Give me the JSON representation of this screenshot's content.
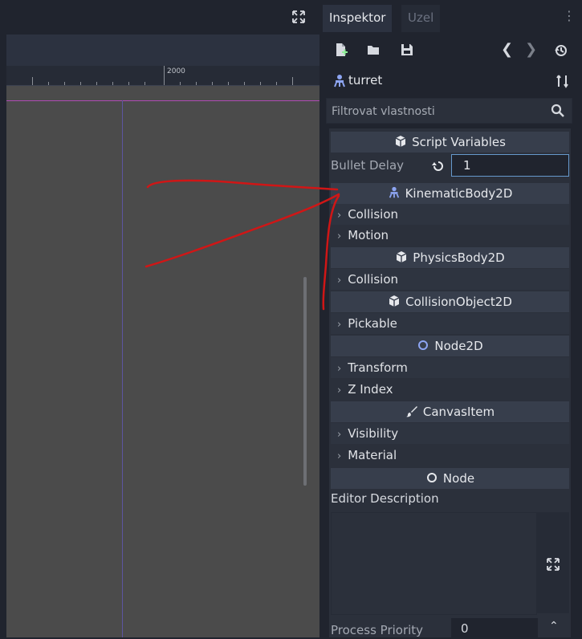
{
  "dock": {
    "tab_inspector": "Inspektor",
    "tab_node": "Uzel",
    "menu_glyph": "⋮"
  },
  "toolbar": {
    "icons": [
      "new-resource-icon",
      "open-folder-icon",
      "save-icon",
      "history-back-icon",
      "history-forward-icon",
      "object-history-icon"
    ],
    "back_glyph": "❮",
    "forward_glyph": "❯"
  },
  "object": {
    "name": "turret",
    "icon": "kinematic-body-icon"
  },
  "filter": {
    "placeholder": "Filtrovat vlastnosti"
  },
  "ruler": {
    "label": "2000"
  },
  "sections": {
    "script_variables": "Script Variables",
    "kinematic": "KinematicBody2D",
    "physics": "PhysicsBody2D",
    "collision_object": "CollisionObject2D",
    "node2d": "Node2D",
    "canvas_item": "CanvasItem",
    "node": "Node"
  },
  "properties": {
    "bullet_delay_label": "Bullet Delay",
    "bullet_delay_value": "1"
  },
  "groups": {
    "collision1": "Collision",
    "motion": "Motion",
    "collision2": "Collision",
    "pickable": "Pickable",
    "transform": "Transform",
    "z_index": "Z Index",
    "visibility": "Visibility",
    "material": "Material"
  },
  "editor_description": {
    "label": "Editor Description"
  },
  "process_priority": {
    "label": "Process Priority",
    "value": "0"
  },
  "colors": {
    "accent_blue": "#6699cc",
    "panel_bg": "#20242e",
    "annotation_red": "#d01616"
  }
}
